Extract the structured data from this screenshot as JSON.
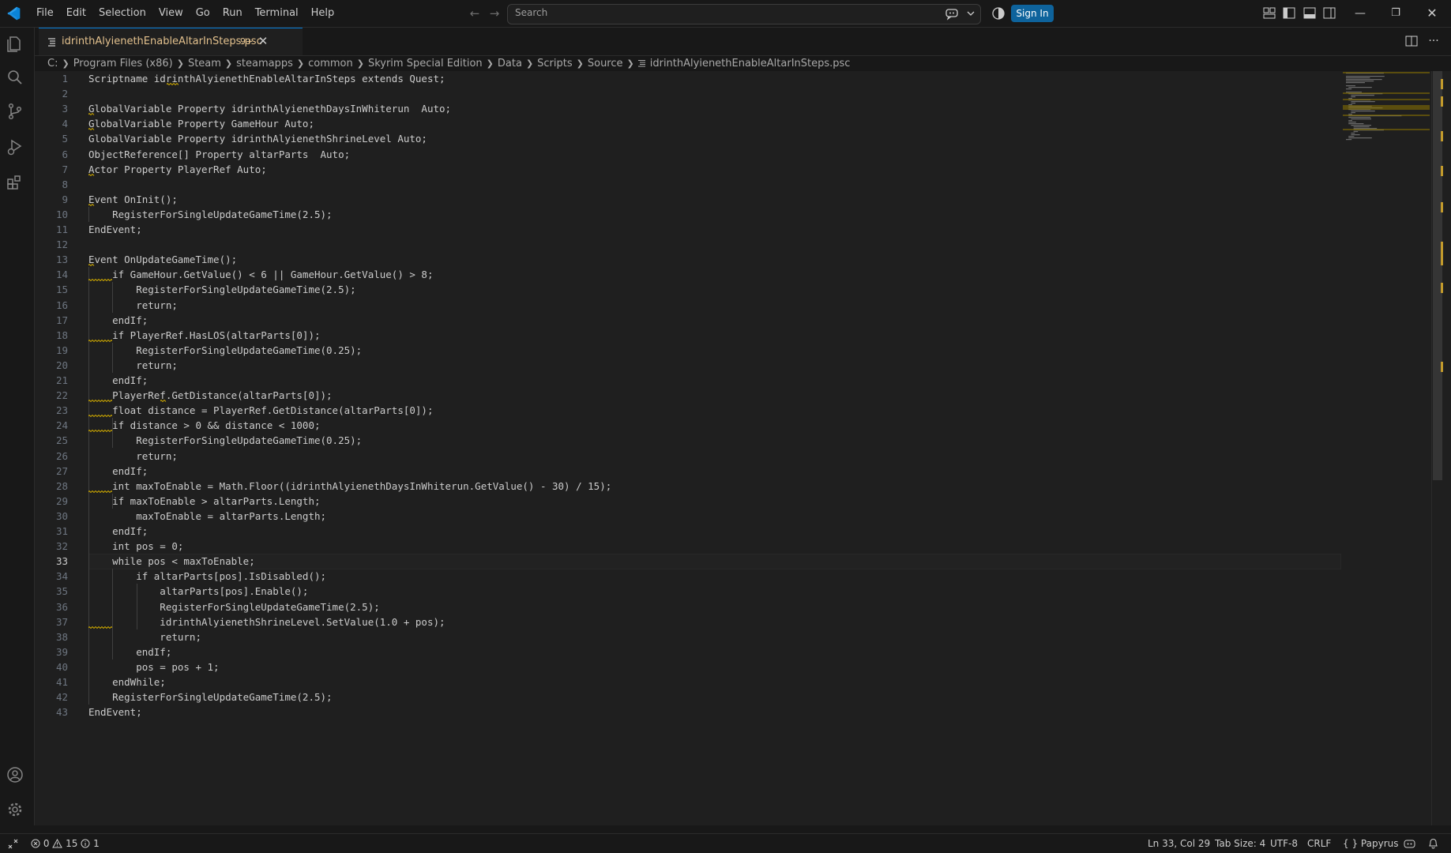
{
  "titlebar": {
    "menu": [
      "File",
      "Edit",
      "Selection",
      "View",
      "Go",
      "Run",
      "Terminal",
      "Help"
    ],
    "search_placeholder": "Search",
    "sign_in_label": "Sign In",
    "icons": [
      "vscode-logo-icon",
      "arrow-left-icon",
      "arrow-right-icon",
      "copilot-icon",
      "chevron-down-icon",
      "accounts-shield-icon",
      "customize-layout-icon",
      "toggle-primary-sidebar-icon",
      "toggle-panel-icon",
      "toggle-secondary-sidebar-icon",
      "minimize-icon",
      "restore-icon",
      "close-icon"
    ]
  },
  "activitybar": {
    "items": [
      "explorer-icon",
      "search-icon",
      "source-control-icon",
      "run-debug-icon",
      "extensions-icon"
    ],
    "bottom": [
      "accounts-icon",
      "manage-gear-icon"
    ]
  },
  "tabs": [
    {
      "label": "idrinthAlyienethEnableAltarInSteps.psc",
      "badge": "9+",
      "active": true
    }
  ],
  "editor_actions": [
    "split-editor-icon",
    "more-actions-icon"
  ],
  "breadcrumbs": [
    "C:",
    "Program Files (x86)",
    "Steam",
    "steamapps",
    "common",
    "Skyrim Special Edition",
    "Data",
    "Scripts",
    "Source",
    "idrinthAlyienethEnableAltarInSteps.psc"
  ],
  "code": {
    "current_line": 33,
    "lines": [
      "Scriptname idrinthAlyienethEnableAltarInSteps extends Quest;",
      "",
      "GlobalVariable Property idrinthAlyienethDaysInWhiterun  Auto;",
      "GlobalVariable Property GameHour Auto;",
      "GlobalVariable Property idrinthAlyienethShrineLevel Auto;",
      "ObjectReference[] Property altarParts  Auto;",
      "Actor Property PlayerRef Auto;",
      "",
      "Event OnInit();",
      "    RegisterForSingleUpdateGameTime(2.5);",
      "EndEvent;",
      "",
      "Event OnUpdateGameTime();",
      "    if GameHour.GetValue() < 6 || GameHour.GetValue() > 8;",
      "        RegisterForSingleUpdateGameTime(2.5);",
      "        return;",
      "    endIf;",
      "    if PlayerRef.HasLOS(altarParts[0]);",
      "        RegisterForSingleUpdateGameTime(0.25);",
      "        return;",
      "    endIf;",
      "    PlayerRef.GetDistance(altarParts[0]);",
      "    float distance = PlayerRef.GetDistance(altarParts[0]);",
      "    if distance > 0 && distance < 1000;",
      "        RegisterForSingleUpdateGameTime(0.25);",
      "        return;",
      "    endIf;",
      "    int maxToEnable = Math.Floor((idrinthAlyienethDaysInWhiterun.GetValue() - 30) / 15);",
      "    if maxToEnable > altarParts.Length;",
      "        maxToEnable = altarParts.Length;",
      "    endIf;",
      "    int pos = 0;",
      "    while pos < maxToEnable;",
      "        if altarParts[pos].IsDisabled();",
      "            altarParts[pos].Enable();",
      "            RegisterForSingleUpdateGameTime(2.5);",
      "            idrinthAlyienethShrineLevel.SetValue(1.0 + pos);",
      "            return;",
      "        endIf;",
      "        pos = pos + 1;",
      "    endWhile;",
      "    RegisterForSingleUpdateGameTime(2.5);",
      "EndEvent;"
    ]
  },
  "statusbar": {
    "errors": "0",
    "warnings": "15",
    "infos": "1",
    "cursor": "Ln 33, Col 29",
    "tab_size": "Tab Size: 4",
    "encoding": "UTF-8",
    "eol": "CRLF",
    "language": "Papyrus"
  },
  "colors": {
    "background": "#1f1f1f",
    "chrome": "#181818",
    "accent": "#0078d4",
    "sign_in_button": "#0e639c",
    "warning_squiggle": "#cca700",
    "modified_tab_text": "#e2c08d"
  }
}
